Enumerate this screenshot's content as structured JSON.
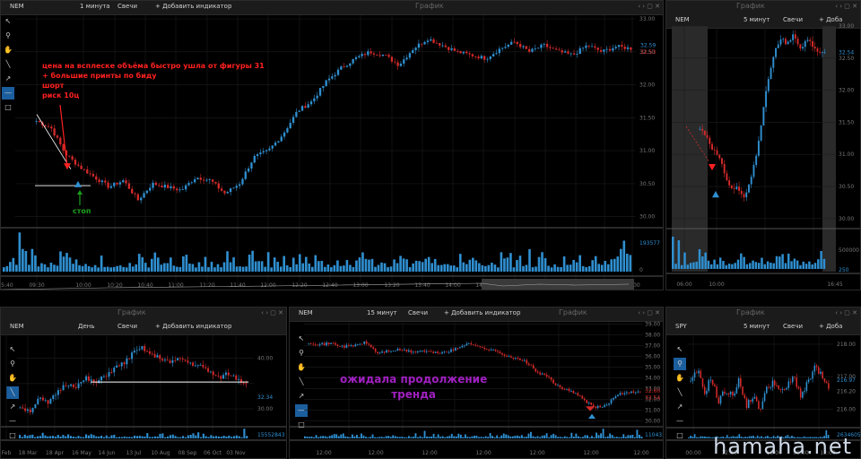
{
  "panels": {
    "tl": {
      "ticker": "NEM",
      "interval": "1 минута",
      "type": "Свечи",
      "add": "+ Добавить индикатор",
      "center": "График",
      "y": [
        "33.00",
        "32.50",
        "32.00",
        "31.50",
        "31.00",
        "30.50",
        "30.00"
      ],
      "price": "32.59",
      "price2": "32.53",
      "volume": [
        "193577",
        "0"
      ],
      "x": [
        "15:40",
        "09:30",
        "10:00",
        "10:20",
        "10:40",
        "11:00",
        "11:20",
        "11:40",
        "12:00",
        "12:20",
        "12:40",
        "13:00",
        "13:20",
        "13:40",
        "14:00",
        "14:20",
        "14:40",
        "15:00",
        "15:20",
        "15:40",
        "16:00"
      ]
    },
    "tr": {
      "center": "График",
      "ticker": "NEM",
      "interval": "5 минут",
      "type": "Свечи",
      "add": "+ Доба",
      "y": [
        "33.00",
        "32.50",
        "32.00",
        "31.50",
        "31.00",
        "30.50",
        "30.00"
      ],
      "price": "32.54",
      "volume": [
        "500000",
        "250"
      ],
      "x": [
        "06:00",
        "10:00",
        "16:45"
      ]
    },
    "bl": {
      "center": "График",
      "ticker": "NEM",
      "interval": "День",
      "type": "Свечи",
      "add": "+ Добавить индикатор",
      "y": [
        "40.00",
        "32.34",
        "30.00"
      ],
      "volume": "15552843",
      "x": [
        "Feb",
        "18 Mar",
        "18 Apr",
        "16 May",
        "14 Jun",
        "13 Jul",
        "10 Aug",
        "08 Sep",
        "06 Oct",
        "03 Nov"
      ]
    },
    "bc": {
      "ticker": "NEM",
      "interval": "15 минут",
      "type": "Свечи",
      "add": "+ Добавить индикатор",
      "center": "График",
      "y": [
        "39.00",
        "38.00",
        "37.00",
        "36.00",
        "35.00",
        "34.00",
        "33.00",
        "32.00",
        "31.00",
        "30.00"
      ],
      "price": "32.60",
      "price2": "32.54",
      "volume": "1104334",
      "x": [
        "12:00",
        "12:00",
        "12:00",
        "12:00",
        "12:00",
        "12:00",
        "12:00"
      ]
    },
    "br": {
      "center": "График",
      "ticker": "SPY",
      "interval": "5 минут",
      "type": "Свечи",
      "add": "+ Доба",
      "y": [
        "218.00",
        "217.00",
        "216.00"
      ],
      "price": "216.97",
      "price2": "216.20",
      "volume": "2634605",
      "x": [
        "00:00",
        "12:00",
        "16:00",
        "00:00",
        "12:00"
      ]
    }
  },
  "annotations": {
    "red_note": [
      "цена на всплеске объёма быстро ушла от фигуры 31",
      "+ большие принты по биду",
      "шорт",
      "риск 10ц"
    ],
    "stop": "стоп",
    "purple_note": [
      "ожидала продолжение",
      "тренда"
    ]
  },
  "watermark": "hamaha.net",
  "colors": {
    "up": "#2f8fd0",
    "down": "#d42a2a",
    "volume": "#2f8fd0",
    "accent": "#1b5e9e",
    "red_note": "#ff2020",
    "purple": "#a020c0",
    "stop": "#1aa01a"
  }
}
